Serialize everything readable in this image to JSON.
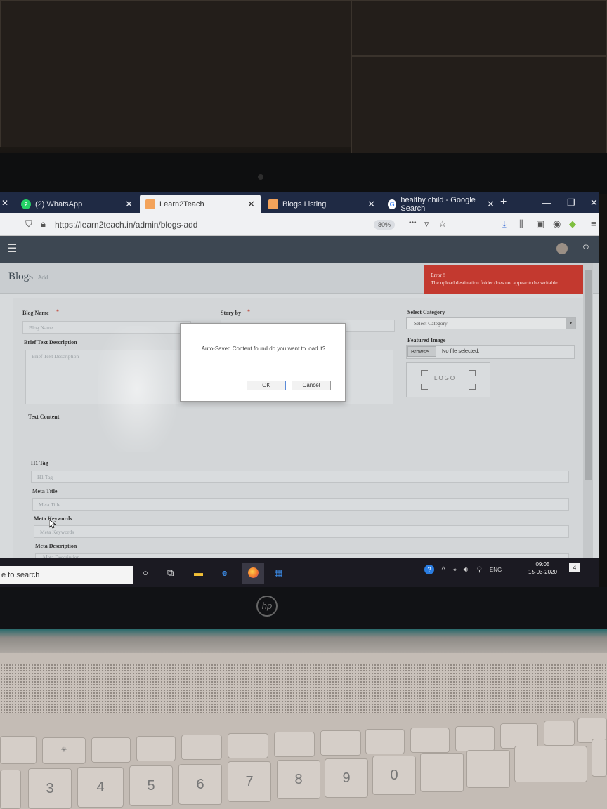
{
  "browser": {
    "tabs": [
      {
        "label": "(2) WhatsApp",
        "close": "✕"
      },
      {
        "label": "Learn2Teach",
        "close": "✕"
      },
      {
        "label": "Blogs Listing",
        "close": "✕"
      },
      {
        "label": "healthy child - Google Search",
        "close": "✕"
      }
    ],
    "new_tab": "+",
    "window_controls": {
      "minimize": "—",
      "restore": "❐",
      "close": "✕"
    },
    "url": "https://learn2teach.in/admin/blogs-add",
    "zoom": "80%",
    "more": "•••",
    "menu": "≡"
  },
  "page": {
    "title": "Blogs",
    "subtitle": "Add",
    "error": {
      "title": "Error !",
      "message": "The upload destination folder does not appear to be writable."
    },
    "form": {
      "blog_name_label": "Blog Name",
      "blog_name_placeholder": "Blog Name",
      "story_by_label": "Story by",
      "select_category_label": "Select Category",
      "select_category_value": "Select Category",
      "brief_label": "Brief Text Description",
      "brief_placeholder": "Brief Text Description",
      "featured_image_label": "Featured Image",
      "browse_label": "Browse...",
      "no_file": "No file selected.",
      "logo_text": "LOGO",
      "text_content_label": "Text Content",
      "h1_label": "H1 Tag",
      "h1_placeholder": "H1 Tag",
      "meta_title_label": "Meta Title",
      "meta_title_placeholder": "Meta Title",
      "meta_keywords_label": "Meta Keywords",
      "meta_keywords_placeholder": "Meta Keywords",
      "meta_description_label": "Meta Description",
      "meta_description_placeholder": "Meta Description"
    },
    "dialog": {
      "message": "Auto-Saved Content found do you want to load it?",
      "ok": "OK",
      "cancel": "Cancel"
    }
  },
  "taskbar": {
    "search": "e to search",
    "language": "ENG",
    "time": "09:05",
    "date": "15-03-2020",
    "notifications": "4"
  },
  "colors": {
    "error": "#c3392f",
    "tabbar": "#1f2a44",
    "topnav": "#3d4752"
  }
}
